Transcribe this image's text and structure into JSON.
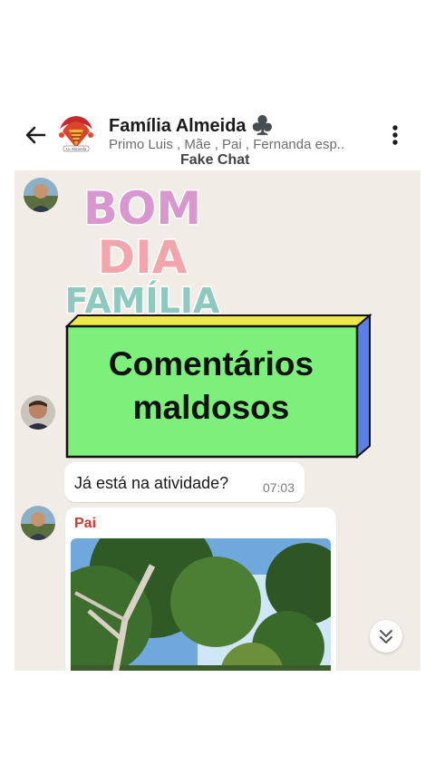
{
  "header": {
    "group_name": "Família Almeida ♣️",
    "members": "Primo Luis , Mãe , Pai , Fernanda esp..",
    "watermark": "Fake Chat",
    "avatar_logo_text": "La Almeida"
  },
  "sticker": {
    "line1": "BOM",
    "line2": "DIA",
    "line3": "FAMÍLIA",
    "line1_color": "#d897cf",
    "line2_color": "#f2a5ab",
    "line3_color": "#8ec9bd"
  },
  "overlay": {
    "line1": "Comentários",
    "line2": "maldosos",
    "fill_color": "#7df07c",
    "top_color": "#ece84a",
    "side_color": "#5b7fe6"
  },
  "messages": [
    {
      "text": "Já está na atividade?",
      "time": "07:03"
    },
    {
      "sender": "Pai",
      "sender_color": "#d8342b",
      "content": "photo-of-trees"
    }
  ],
  "icons": {
    "back": "arrow-left-icon",
    "menu": "more-vert-icon",
    "scroll": "double-chevron-down-icon"
  }
}
